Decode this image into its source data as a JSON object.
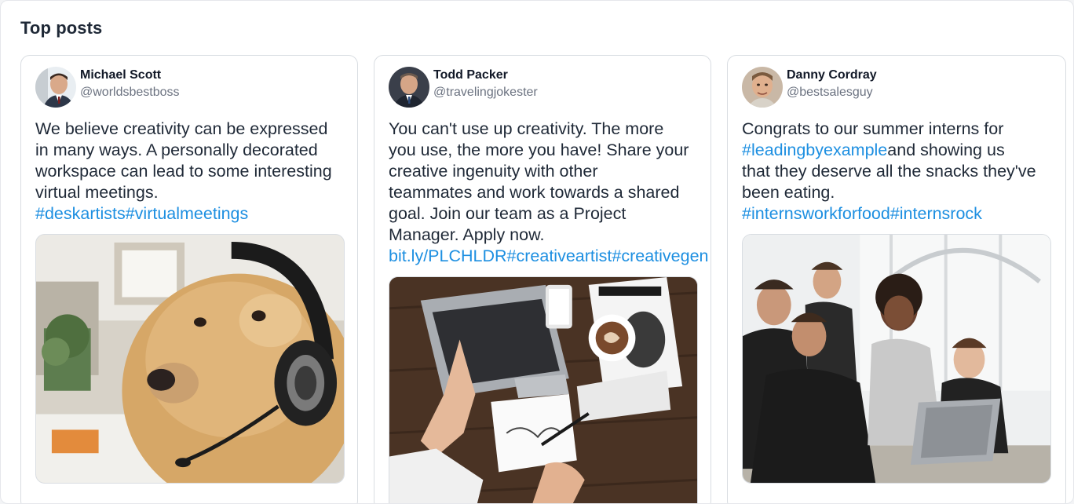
{
  "section": {
    "title": "Top posts"
  },
  "posts": [
    {
      "author": "Michael Scott",
      "handle": "@worldsbestboss",
      "lines": [
        "We believe creativity can be expressed",
        "in many ways. A personally decorated",
        "workspace can lead to some interesting",
        "virtual meetings."
      ],
      "tag_line": "#deskartists#virtualmeetings",
      "image": "dog-with-headphones-at-desk"
    },
    {
      "author": "Todd Packer",
      "handle": "@travelingjokester",
      "lines": [
        "You can't use up creativity. The more",
        "you use, the more you have! Share your",
        "creative ingenuity with other",
        "teammates and work towards a shared",
        "goal. Join our team as a Project",
        "Manager. Apply now."
      ],
      "tag_line": "bit.ly/PLCHLDR#creativeartist#creativegen",
      "image": "overhead-desk-laptop-coffee"
    },
    {
      "author": "Danny Cordray",
      "handle": "@bestsalesguy",
      "line_parts": [
        {
          "text": "Congrats to our summer interns for",
          "tag": ""
        },
        {
          "text": "and showing us",
          "tag": "#leadingbyexample"
        },
        {
          "text": "that they deserve all the snacks they've",
          "tag": ""
        },
        {
          "text": "been eating.",
          "tag": ""
        }
      ],
      "tag_line": "#internsworkforfood#internsrock",
      "image": "team-around-laptop"
    }
  ],
  "colors": {
    "link": "#1d8fe1",
    "text": "#1f2937",
    "muted": "#6b7280",
    "border": "#d9dde2"
  }
}
